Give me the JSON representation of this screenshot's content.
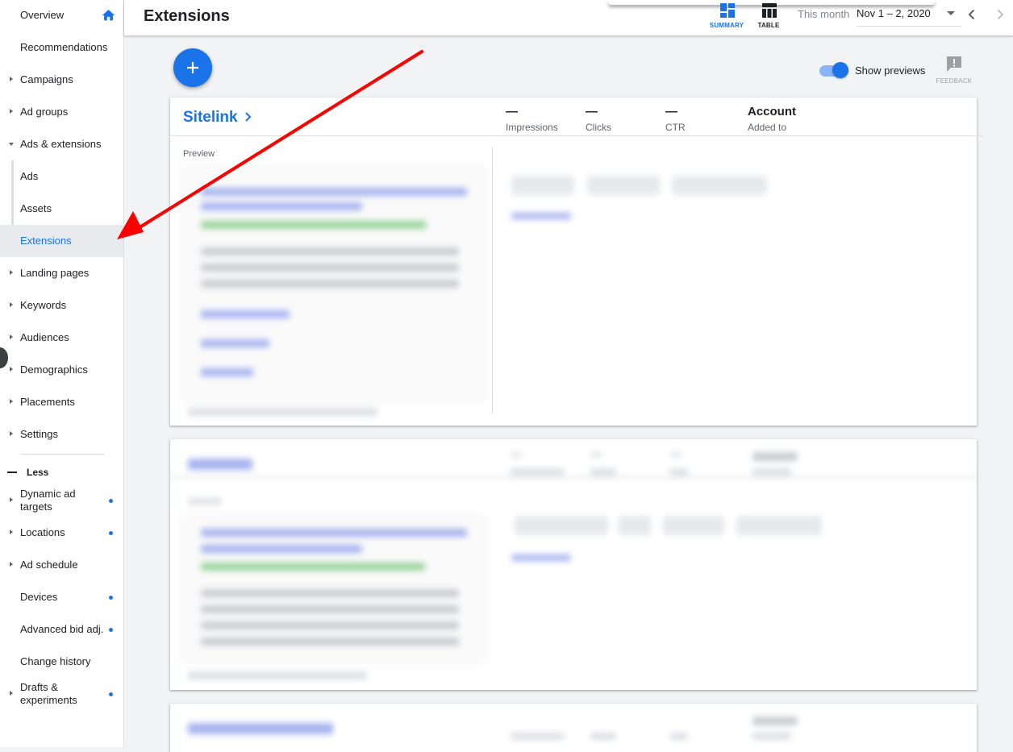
{
  "sidebar": {
    "items": [
      {
        "label": "Overview",
        "caret": "none"
      },
      {
        "label": "Recommendations",
        "caret": "none"
      },
      {
        "label": "Campaigns",
        "caret": "right"
      },
      {
        "label": "Ad groups",
        "caret": "right"
      },
      {
        "label": "Ads & extensions",
        "caret": "down"
      },
      {
        "label": "Ads",
        "caret": "none"
      },
      {
        "label": "Assets",
        "caret": "none"
      },
      {
        "label": "Extensions",
        "caret": "none",
        "selected": true
      },
      {
        "label": "Landing pages",
        "caret": "right"
      },
      {
        "label": "Keywords",
        "caret": "right"
      },
      {
        "label": "Audiences",
        "caret": "right"
      },
      {
        "label": "Demographics",
        "caret": "right"
      },
      {
        "label": "Placements",
        "caret": "right"
      },
      {
        "label": "Settings",
        "caret": "right"
      }
    ],
    "less_label": "Less",
    "more_items": [
      {
        "label": "Dynamic ad targets",
        "caret": "right",
        "dot": true
      },
      {
        "label": "Locations",
        "caret": "right",
        "dot": true
      },
      {
        "label": "Ad schedule",
        "caret": "right",
        "dot": false
      },
      {
        "label": "Devices",
        "caret": "none",
        "dot": true
      },
      {
        "label": "Advanced bid adj.",
        "caret": "none",
        "dot": true
      },
      {
        "label": "Change history",
        "caret": "none",
        "dot": false
      },
      {
        "label": "Drafts & experiments",
        "caret": "right",
        "dot": true
      }
    ]
  },
  "header": {
    "title": "Extensions",
    "summary_label": "SUMMARY",
    "table_label": "TABLE",
    "date_label": "This month",
    "date_range": "Nov 1 – 2, 2020"
  },
  "toolbar": {
    "show_previews_label": "Show previews",
    "show_previews_on": true,
    "feedback_label": "FEEDBACK"
  },
  "cards": [
    {
      "title": "Sitelink",
      "stats": [
        {
          "value": "—",
          "name": "Impressions"
        },
        {
          "value": "—",
          "name": "Clicks"
        },
        {
          "value": "—",
          "name": "CTR"
        },
        {
          "value": "Account",
          "name": "Added to"
        }
      ],
      "preview_label": "Preview"
    }
  ],
  "colors": {
    "accent": "#1a73e8",
    "annotation_arrow": "#ff0000"
  }
}
